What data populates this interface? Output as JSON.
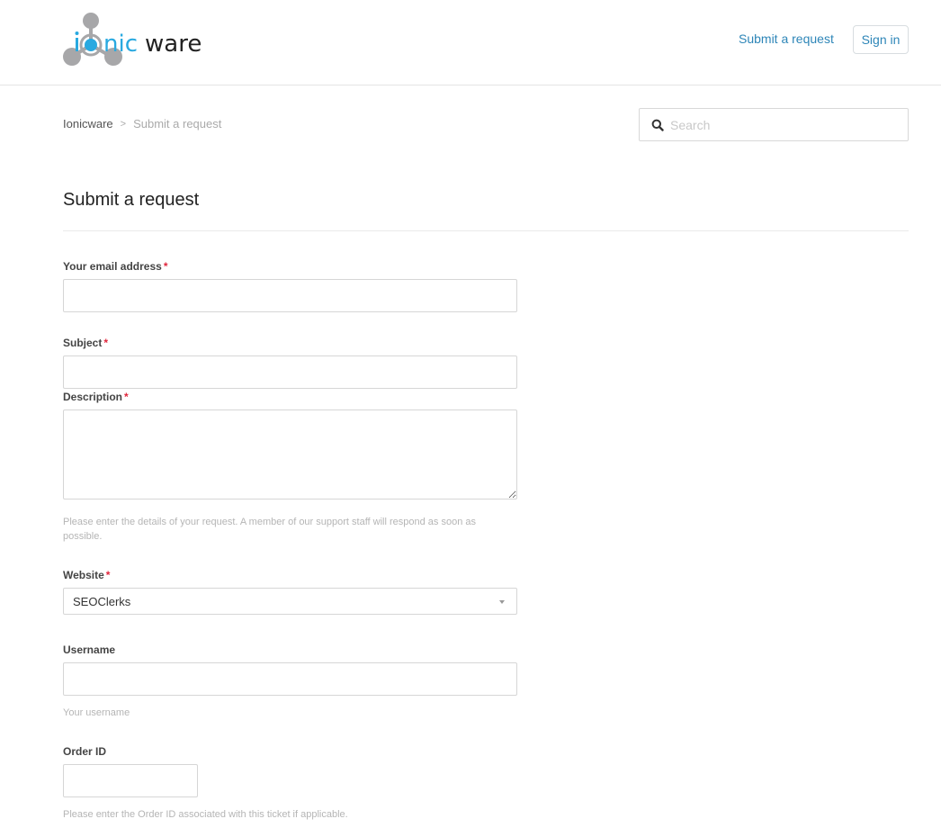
{
  "header": {
    "logo_text": "ionicware",
    "nav_submit_request": "Submit a request",
    "sign_in": "Sign in"
  },
  "breadcrumbs": {
    "items": [
      "Ionicware",
      "Submit a request"
    ],
    "separator": ">"
  },
  "search": {
    "placeholder": "Search",
    "icon": "search-icon"
  },
  "page": {
    "title": "Submit a request"
  },
  "form": {
    "required_marker": "*",
    "email": {
      "label": "Your email address",
      "required": true,
      "value": ""
    },
    "subject": {
      "label": "Subject",
      "required": true,
      "value": ""
    },
    "description": {
      "label": "Description",
      "required": true,
      "value": "",
      "hint": "Please enter the details of your request. A member of our support staff will respond as soon as possible."
    },
    "website": {
      "label": "Website",
      "required": true,
      "selected": "SEOClerks"
    },
    "username": {
      "label": "Username",
      "required": false,
      "value": "",
      "hint": "Your username"
    },
    "order_id": {
      "label": "Order ID",
      "required": false,
      "value": "",
      "hint": "Please enter the Order ID associated with this ticket if applicable."
    }
  },
  "colors": {
    "link": "#2e86b8",
    "logo_blue": "#29a9e0",
    "logo_gray": "#a7a7a9",
    "required": "#e0263c"
  }
}
